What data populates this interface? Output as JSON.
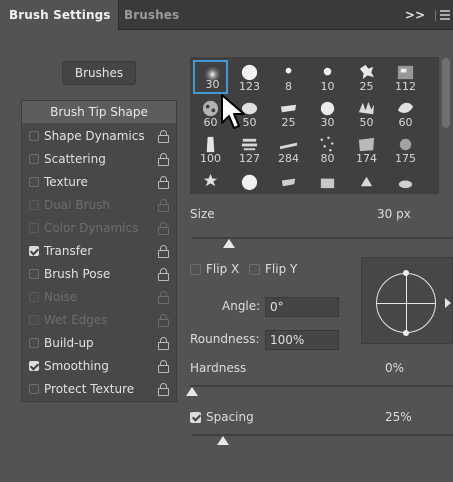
{
  "tabs": [
    {
      "label": "Brush Settings"
    },
    {
      "label": "Brushes"
    }
  ],
  "tabbar": {
    "more_label": ">>"
  },
  "brushes_button": {
    "label": "Brushes"
  },
  "left_panel": {
    "tip_shape_label": "Brush Tip Shape",
    "options": [
      {
        "label": "Shape Dynamics",
        "checked": false,
        "enabled": true
      },
      {
        "label": "Scattering",
        "checked": false,
        "enabled": true
      },
      {
        "label": "Texture",
        "checked": false,
        "enabled": true
      },
      {
        "label": "Dual Brush",
        "checked": false,
        "enabled": false
      },
      {
        "label": "Color Dynamics",
        "checked": false,
        "enabled": false
      },
      {
        "label": "Transfer",
        "checked": true,
        "enabled": true
      },
      {
        "label": "Brush Pose",
        "checked": false,
        "enabled": true
      },
      {
        "label": "Noise",
        "checked": false,
        "enabled": false
      },
      {
        "label": "Wet Edges",
        "checked": false,
        "enabled": false
      },
      {
        "label": "Build-up",
        "checked": false,
        "enabled": true
      },
      {
        "label": "Smoothing",
        "checked": true,
        "enabled": true
      },
      {
        "label": "Protect Texture",
        "checked": false,
        "enabled": true
      }
    ]
  },
  "brush_grid": {
    "rows": [
      [
        "30",
        "123",
        "8",
        "10",
        "25",
        "112"
      ],
      [
        "60",
        "50",
        "25",
        "30",
        "50",
        "60"
      ],
      [
        "100",
        "127",
        "284",
        "80",
        "174",
        "175"
      ],
      [
        "",
        "",
        "",
        "",
        "",
        ""
      ]
    ],
    "selected": "30"
  },
  "size": {
    "label": "Size",
    "value": "30 px"
  },
  "flip": {
    "x_label": "Flip X",
    "y_label": "Flip Y"
  },
  "angle": {
    "label": "Angle:",
    "value": "0°"
  },
  "roundness": {
    "label": "Roundness:",
    "value": "100%"
  },
  "hardness": {
    "label": "Hardness",
    "value": "0%"
  },
  "spacing": {
    "label": "Spacing",
    "value": "25%",
    "checked": true
  },
  "slider_levels": {
    "size_fraction": 0.15,
    "hardness_fraction": 0.0,
    "spacing_fraction": 0.13
  }
}
